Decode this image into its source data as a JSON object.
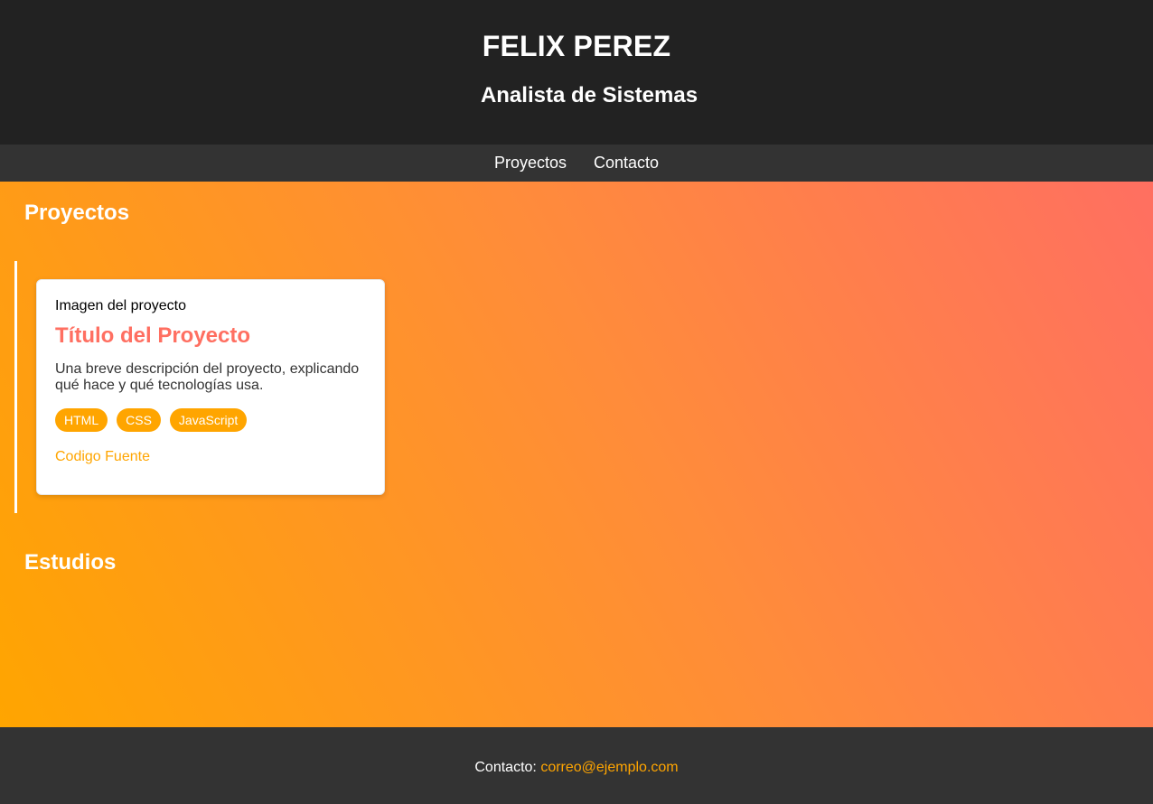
{
  "header": {
    "title": "FELIX PEREZ",
    "subtitle": "Analista de Sistemas"
  },
  "nav": {
    "items": [
      "Proyectos",
      "Contacto"
    ]
  },
  "sections": {
    "projects_heading": "Proyectos",
    "studies_heading": "Estudios"
  },
  "projects": [
    {
      "image_alt": "Imagen del proyecto",
      "title": "Título del Proyecto",
      "description": "Una breve descripción del proyecto, explicando qué hace y qué tecnologías usa.",
      "tags": [
        "HTML",
        "CSS",
        "JavaScript"
      ],
      "link_label": "Codigo Fuente"
    }
  ],
  "footer": {
    "label": "Contacto:",
    "email": "correo@ejemplo.com"
  },
  "colors": {
    "accent": "#ffa500",
    "title": "#ff6f61",
    "header_bg": "#222222",
    "nav_bg": "#333333"
  },
  "icons": {
    "project_image": "broken-image-icon"
  }
}
